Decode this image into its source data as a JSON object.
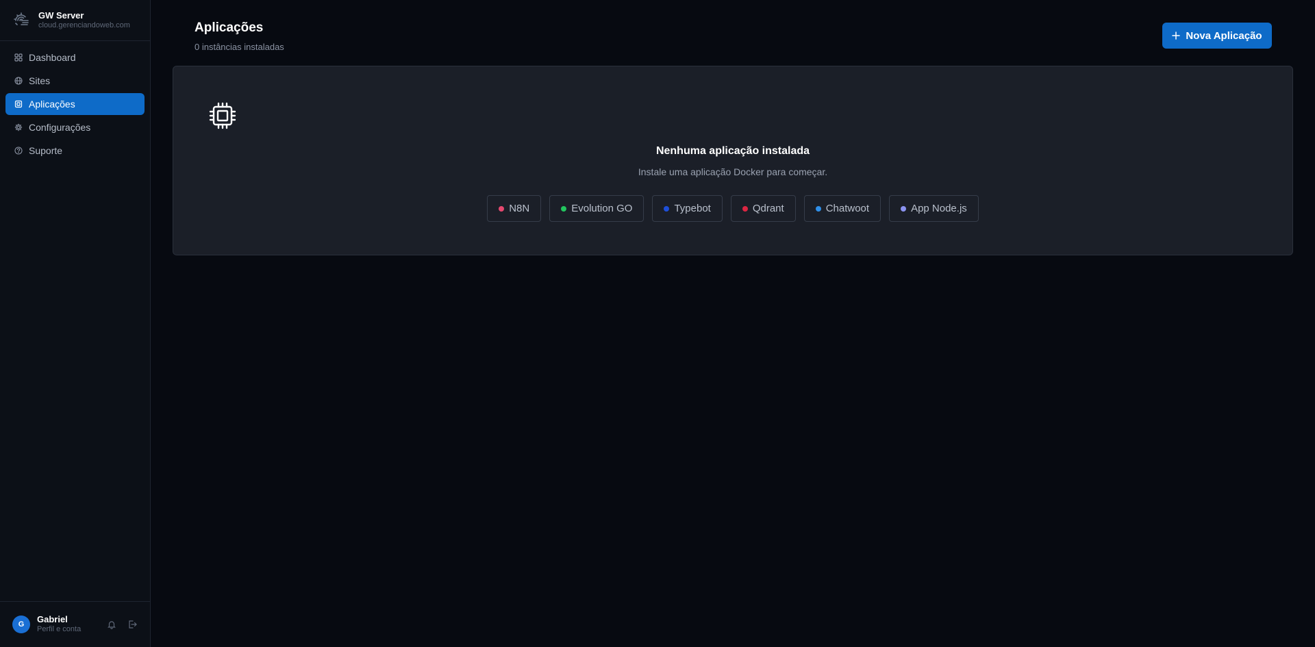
{
  "brand": {
    "title": "GW Server",
    "subtitle": "cloud.gerenciandoweb.com"
  },
  "sidebar": {
    "items": [
      {
        "label": "Dashboard",
        "icon": "grid-icon",
        "active": false
      },
      {
        "label": "Sites",
        "icon": "globe-icon",
        "active": false
      },
      {
        "label": "Aplicações",
        "icon": "chip-icon",
        "active": true
      },
      {
        "label": "Configurações",
        "icon": "gear-icon",
        "active": false
      },
      {
        "label": "Suporte",
        "icon": "help-circle-icon",
        "active": false
      }
    ]
  },
  "user": {
    "initial": "G",
    "name": "Gabriel",
    "subtitle": "Perfil e conta"
  },
  "header": {
    "title": "Aplicações",
    "subtitle": "0 instâncias instaladas",
    "new_button_label": "Nova Aplicação"
  },
  "empty_state": {
    "title": "Nenhuma aplicação instalada",
    "subtitle": "Instale uma aplicação Docker para começar.",
    "tags": [
      {
        "label": "N8N",
        "color": "#e5486f"
      },
      {
        "label": "Evolution GO",
        "color": "#22c55e"
      },
      {
        "label": "Typebot",
        "color": "#1d4ed8"
      },
      {
        "label": "Qdrant",
        "color": "#dc2642"
      },
      {
        "label": "Chatwoot",
        "color": "#2f8fe8"
      },
      {
        "label": "App Node.js",
        "color": "#8b93f0"
      }
    ]
  },
  "colors": {
    "accent": "#0e6bc8",
    "background": "#070a11",
    "sidebar": "#0c1017",
    "card": "#1b1f28"
  }
}
